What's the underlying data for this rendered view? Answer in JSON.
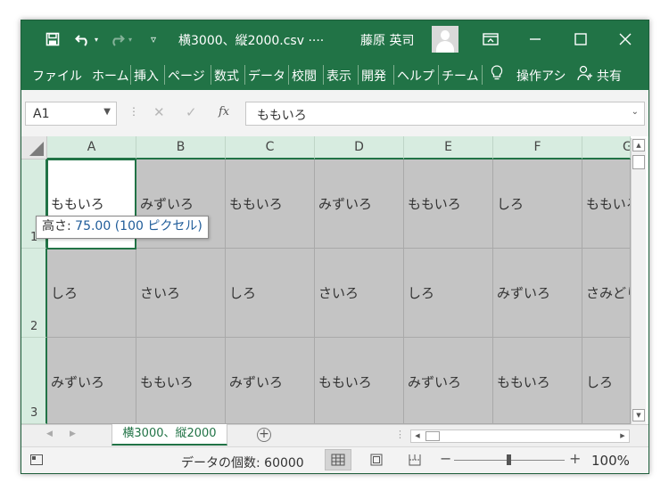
{
  "title_bar": {
    "doc_title": "横3000、縦2000.csv",
    "ellipsis": "····",
    "user_name": "藤原 英司",
    "save_icon": "save-icon",
    "undo_icon": "undo-icon",
    "redo_icon": "redo-icon",
    "customize_icon": "customize-qat-icon"
  },
  "ribbon": {
    "tabs": [
      "ファイル",
      "ホーム",
      "挿入",
      "ページ",
      "数式",
      "データ",
      "校閲",
      "表示",
      "開発",
      "ヘルプ",
      "チーム"
    ],
    "tell_me": "操作アシ",
    "share": "共有"
  },
  "formula_bar": {
    "name_box": "A1",
    "fx": "fx",
    "content": "ももいろ"
  },
  "grid": {
    "columns": [
      "A",
      "B",
      "C",
      "D",
      "E",
      "F",
      "G"
    ],
    "rows": [
      {
        "label": "1",
        "cells": [
          "ももいろ",
          "みずいろ",
          "ももいろ",
          "みずいろ",
          "ももいろ",
          "しろ",
          "ももいろ"
        ]
      },
      {
        "label": "2",
        "cells": [
          "しろ",
          "さいろ",
          "しろ",
          "さいろ",
          "しろ",
          "みずいろ",
          "さみどり"
        ]
      },
      {
        "label": "3",
        "cells": [
          "みずいろ",
          "ももいろ",
          "みずいろ",
          "ももいろ",
          "みずいろ",
          "ももいろ",
          "しろ"
        ]
      }
    ],
    "tooltip_label": "高さ: ",
    "tooltip_value": "75.00 (100 ピクセル)"
  },
  "sheets": {
    "active_tab": "横3000、縦2000"
  },
  "status_bar": {
    "count": "データの個数: 60000",
    "zoom": "100%"
  },
  "colors": {
    "excel_green": "#217346",
    "header_green": "#d7ece0",
    "cell_fill": "#c4c4c4"
  }
}
